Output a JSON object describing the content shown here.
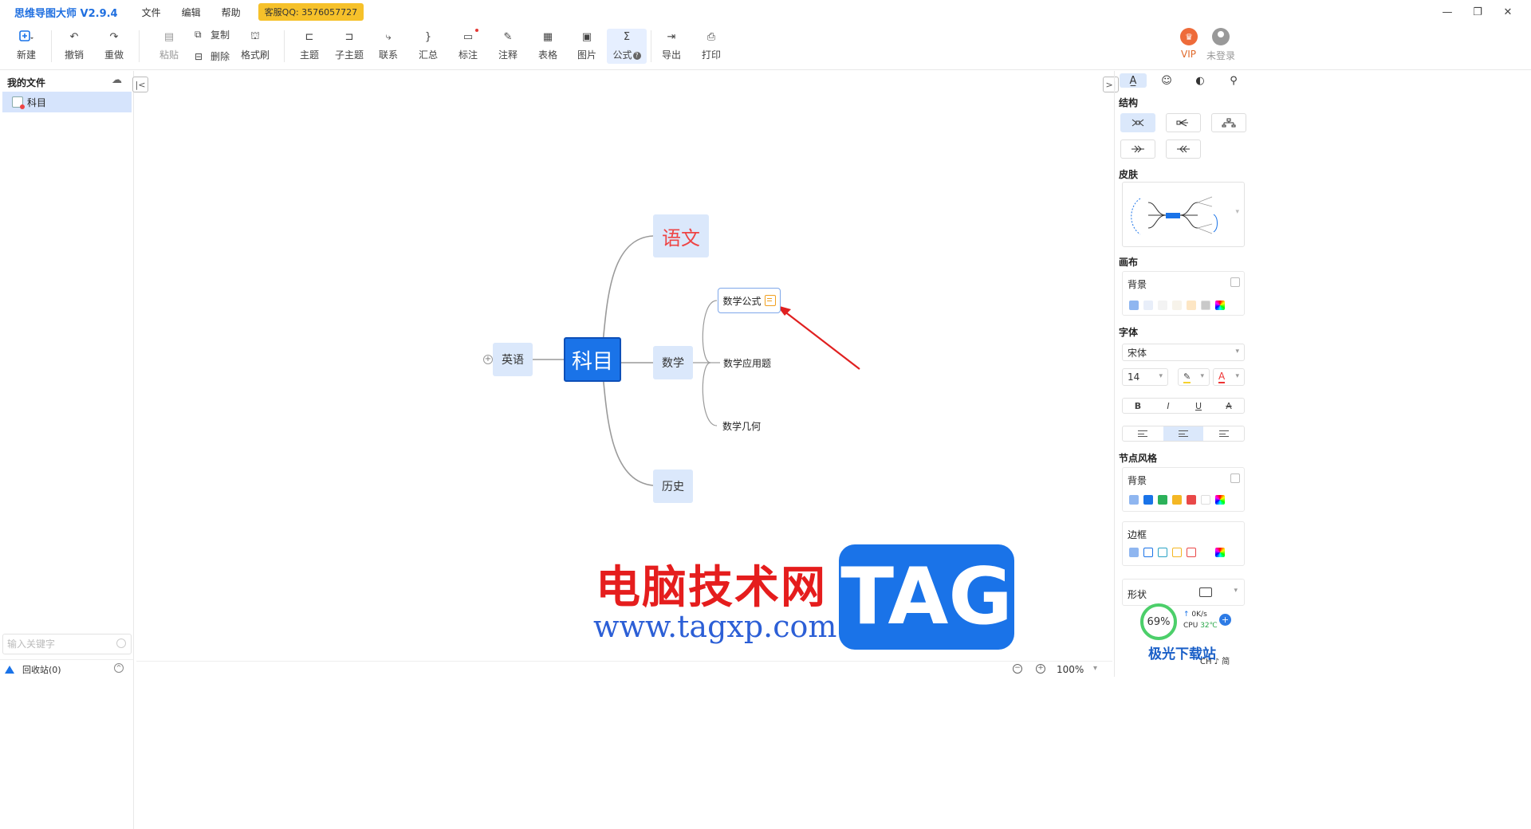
{
  "app": {
    "title": "思维导图大师 V2.9.4",
    "support_qq": "客服QQ: 3576057727"
  },
  "menu": [
    "文件",
    "编辑",
    "帮助"
  ],
  "window_controls": {
    "minimize": "—",
    "restore": "❐",
    "close": "✕"
  },
  "toolbar": {
    "new": "新建",
    "undo": "撤销",
    "redo": "重做",
    "paste": "粘贴",
    "copy": "复制",
    "delete": "删除",
    "format_brush": "格式刷",
    "topic": "主题",
    "subtopic": "子主题",
    "relation": "联系",
    "summary": "汇总",
    "mark": "标注",
    "note": "注释",
    "table": "表格",
    "image": "图片",
    "formula": "公式",
    "export": "导出",
    "print": "打印",
    "vip": "VIP",
    "login": "未登录"
  },
  "sidebar": {
    "title": "我的文件",
    "files": [
      {
        "name": "科目"
      }
    ],
    "search_placeholder": "输入关键字",
    "recycle": "回收站(0)"
  },
  "mindmap": {
    "root": "科目",
    "left": "英语",
    "branches": [
      "语文",
      "数学",
      "历史"
    ],
    "math_children": [
      "数学公式",
      "数学应用题",
      "数学几何"
    ]
  },
  "watermark": {
    "text": "电脑技术网",
    "url": "www.tagxp.com",
    "tag": "TAG"
  },
  "statusbar": {
    "zoom": "100%"
  },
  "right_panel": {
    "structure": "结构",
    "skin": "皮肤",
    "canvas": "画布",
    "background": "背景",
    "font": "字体",
    "font_family": "宋体",
    "font_size": "14",
    "bold": "B",
    "italic": "I",
    "underline": "U",
    "strike": "A",
    "node_style": "节点风格",
    "node_background": "背景",
    "border": "边框",
    "shape": "形状",
    "canvas_colors": [
      "#e8eef9",
      "#f3f3f3",
      "#f7f3ea",
      "#fde6c4",
      "#c9c9c9",
      "#ffffff"
    ],
    "node_bg_colors": [
      "#1a73e8",
      "#2cb15a",
      "#f4b724",
      "#e94848",
      "#ffffff"
    ],
    "border_colors": [
      "#1a73e8",
      "#2aa3c5",
      "#f4b724",
      "#e94848",
      "#ffffff"
    ]
  },
  "system": {
    "cpu_load": "69%",
    "net": "0K/s",
    "cpu_label": "CPU",
    "temp": "32℃",
    "logo": "极光下载站",
    "ime": "CH ♪ 简"
  }
}
